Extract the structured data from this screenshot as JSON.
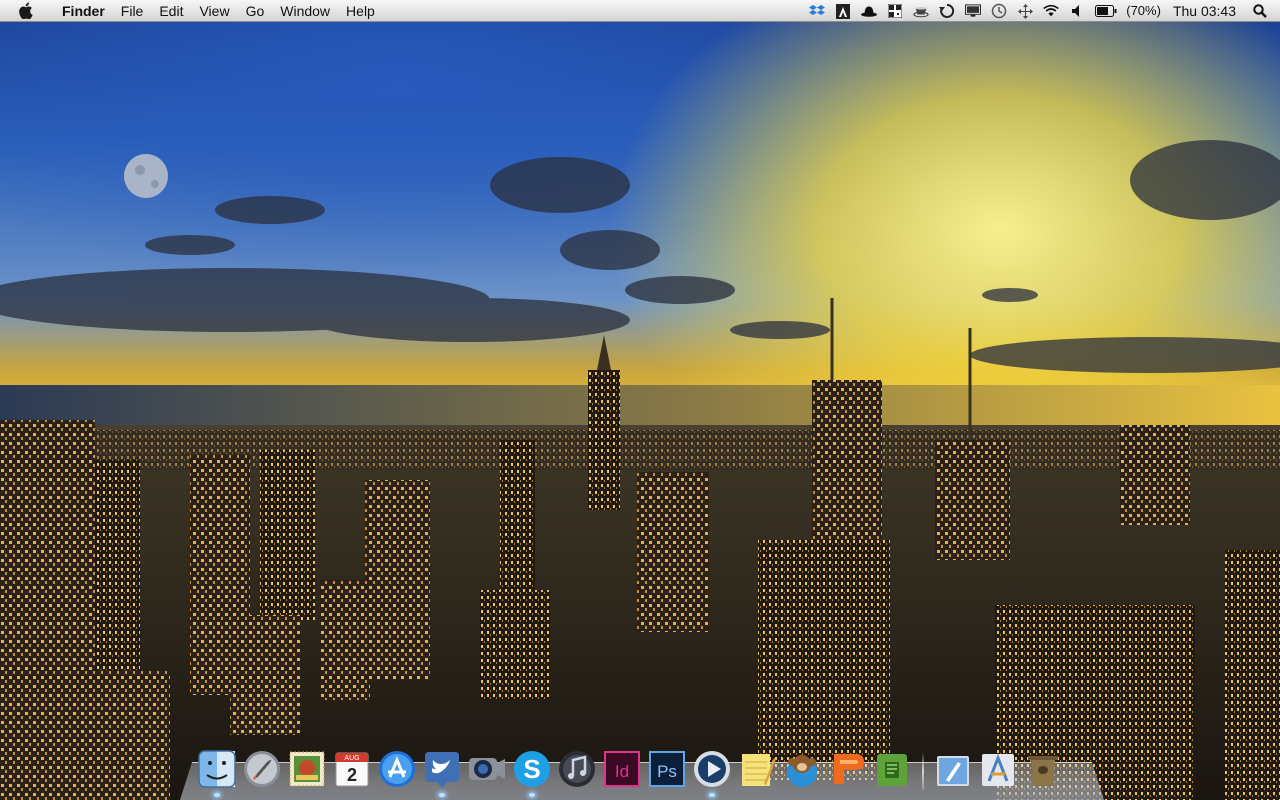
{
  "menubar": {
    "apple_icon": "apple-icon",
    "app_name": "Finder",
    "menus": [
      "File",
      "Edit",
      "View",
      "Go",
      "Window",
      "Help"
    ],
    "status_icons": [
      "dropbox-icon",
      "adobe-icon",
      "bowler-hat-icon",
      "qr-code-icon",
      "coffee-cup-icon",
      "sync-icon",
      "display-icon",
      "time-machine-icon",
      "move-arrows-icon",
      "wifi-icon",
      "volume-icon",
      "battery-icon"
    ],
    "battery_percent": "(70%)",
    "clock": "Thu 03:43",
    "spotlight_icon": "spotlight-search-icon"
  },
  "dock": {
    "apps": [
      {
        "name": "finder",
        "running": true,
        "icon": "finder-icon"
      },
      {
        "name": "launchpad",
        "running": false,
        "icon": "rocket-icon"
      },
      {
        "name": "mail-stamp",
        "running": false,
        "icon": "stamp-icon"
      },
      {
        "name": "calendar",
        "running": false,
        "icon": "calendar-icon",
        "label_month": "AUG",
        "label_day": "2"
      },
      {
        "name": "app-store",
        "running": false,
        "icon": "app-store-icon"
      },
      {
        "name": "twitter",
        "running": true,
        "icon": "twitter-bird-icon"
      },
      {
        "name": "facetime",
        "running": false,
        "icon": "camera-icon"
      },
      {
        "name": "skype",
        "running": true,
        "icon": "skype-icon",
        "label": "S"
      },
      {
        "name": "itunes",
        "running": false,
        "icon": "music-note-icon"
      },
      {
        "name": "indesign",
        "running": false,
        "icon": "indesign-icon",
        "label": "Id"
      },
      {
        "name": "photoshop",
        "running": false,
        "icon": "photoshop-icon",
        "label": "Ps"
      },
      {
        "name": "quicktime",
        "running": true,
        "icon": "play-icon"
      },
      {
        "name": "notes",
        "running": false,
        "icon": "notepad-icon"
      },
      {
        "name": "monkey",
        "running": false,
        "icon": "monkey-icon"
      },
      {
        "name": "pages",
        "running": false,
        "icon": "pages-icon"
      },
      {
        "name": "evernote",
        "running": false,
        "icon": "evernote-icon"
      }
    ],
    "right_items": [
      {
        "name": "documents-folder",
        "icon": "pen-folder-icon"
      },
      {
        "name": "applications-folder",
        "icon": "applications-folder-icon"
      },
      {
        "name": "trash",
        "icon": "trash-icon"
      }
    ]
  }
}
